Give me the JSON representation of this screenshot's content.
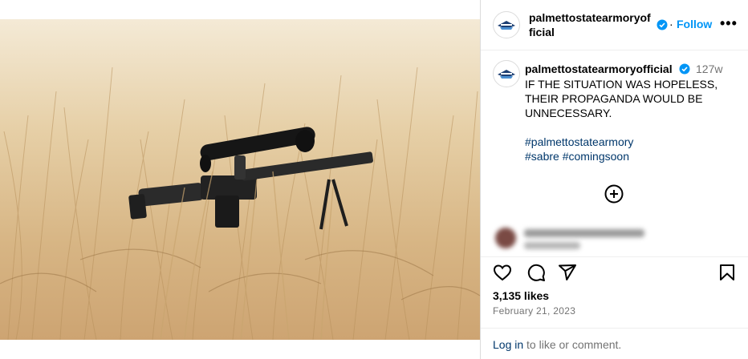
{
  "post": {
    "username": "palmettostatearmoryofficial",
    "follow_label": "Follow",
    "more_label": "•••",
    "separator": "·"
  },
  "caption": {
    "username": "palmettostatearmoryofficial",
    "time": "127w",
    "text": "IF THE SITUATION WAS HOPELESS, THEIR PROPAGANDA WOULD BE UNNECESSARY.",
    "hashtags": [
      "#palmettostatearmory",
      "#sabre",
      "#comingsoon"
    ]
  },
  "stats": {
    "likes": "3,135 likes",
    "date": "February 21, 2023"
  },
  "footer": {
    "login_link": "Log in",
    "login_rest": " to like or comment."
  },
  "colors": {
    "accent": "#0095f6",
    "link": "#00376b",
    "muted": "#737373",
    "verified": "#0095f6"
  },
  "icons": [
    "verified-badge-icon",
    "add-circle-icon",
    "heart-icon",
    "comment-icon",
    "share-icon",
    "bookmark-icon",
    "more-icon"
  ]
}
